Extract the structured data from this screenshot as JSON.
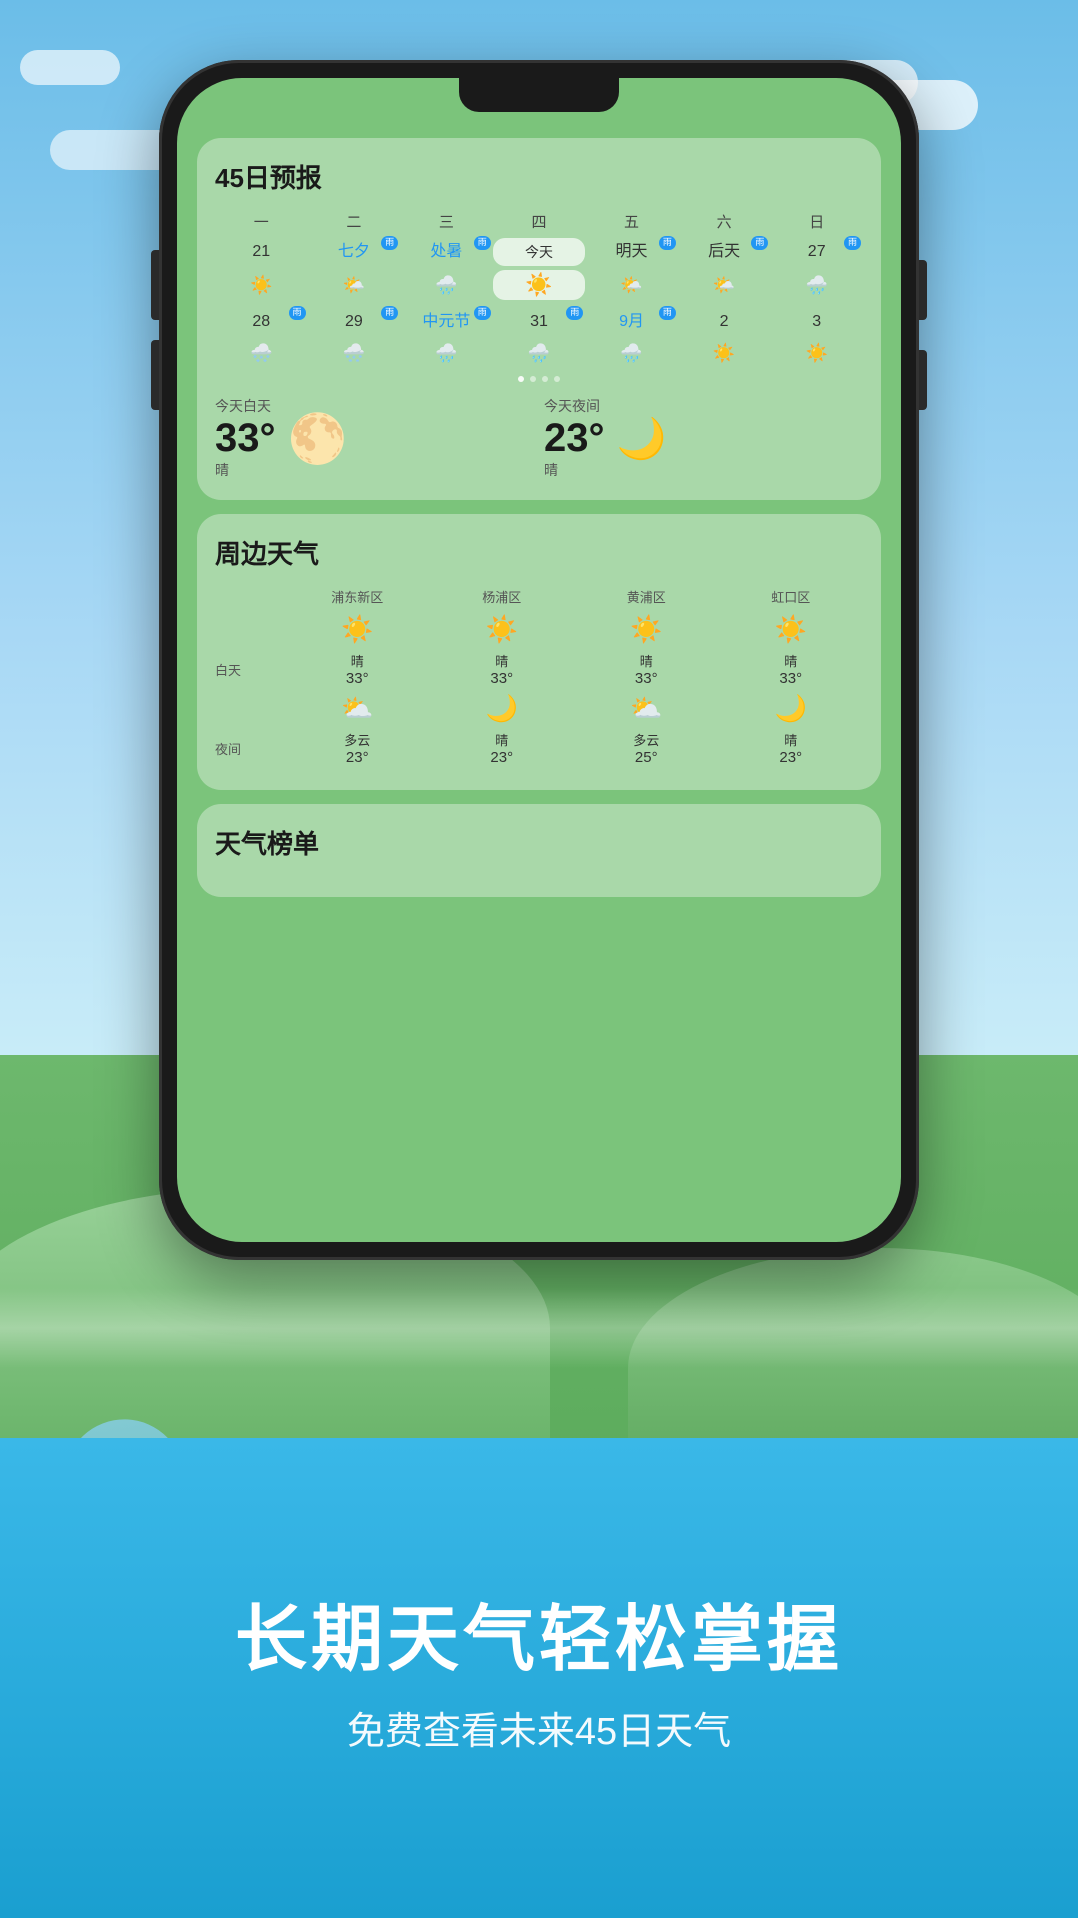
{
  "background": {
    "sky_color": "#87CEEB",
    "grass_color": "#5aaa5a"
  },
  "phone": {
    "screen_bg": "#7bc47b"
  },
  "forecast_card": {
    "title": "45日预报",
    "weekdays": [
      "一",
      "二",
      "三",
      "四",
      "五",
      "六",
      "日"
    ],
    "row1": [
      {
        "date": "21",
        "holiday": "",
        "rain": false,
        "today": false,
        "icon": "☀️"
      },
      {
        "date": "七夕",
        "holiday": "七夕",
        "rain": true,
        "today": false,
        "icon": "🌤️"
      },
      {
        "date": "处暑",
        "holiday": "处暑",
        "rain": true,
        "today": false,
        "icon": "🌧️"
      },
      {
        "date": "今天",
        "holiday": "今天",
        "rain": false,
        "today": true,
        "icon": "☀️"
      },
      {
        "date": "明天",
        "holiday": "明天",
        "rain": true,
        "today": false,
        "icon": "🌤️"
      },
      {
        "date": "后天",
        "holiday": "后天",
        "rain": true,
        "today": false,
        "icon": "🌤️"
      },
      {
        "date": "27",
        "holiday": "",
        "rain": true,
        "today": false,
        "icon": "🌧️"
      }
    ],
    "row2": [
      {
        "date": "28",
        "holiday": "",
        "rain": true,
        "today": false,
        "icon": "🌨️"
      },
      {
        "date": "29",
        "holiday": "",
        "rain": true,
        "today": false,
        "icon": "🌨️"
      },
      {
        "date": "中元节",
        "holiday": "中元节",
        "rain": true,
        "today": false,
        "icon": "🌧️"
      },
      {
        "date": "31",
        "holiday": "",
        "rain": true,
        "today": false,
        "icon": "🌧️"
      },
      {
        "date": "9月",
        "holiday": "9月",
        "rain": true,
        "today": false,
        "icon": "🌧️"
      },
      {
        "date": "2",
        "holiday": "",
        "rain": false,
        "today": false,
        "icon": "☀️"
      },
      {
        "date": "3",
        "holiday": "",
        "rain": false,
        "today": false,
        "icon": "☀️"
      }
    ],
    "day_label": "今天白天",
    "day_temp": "33°",
    "day_desc": "晴",
    "night_label": "今天夜间",
    "night_temp": "23°",
    "night_desc": "晴"
  },
  "nearby_card": {
    "title": "周边天气",
    "districts": [
      "浦东新区",
      "杨浦区",
      "黄浦区",
      "虹口区"
    ],
    "day_label": "白天",
    "night_label": "夜间",
    "day_weather": [
      {
        "icon": "☀️",
        "desc": "晴",
        "temp": "33°"
      },
      {
        "icon": "☀️",
        "desc": "晴",
        "temp": "33°"
      },
      {
        "icon": "☀️",
        "desc": "晴",
        "temp": "33°"
      },
      {
        "icon": "☀️",
        "desc": "晴",
        "temp": "33°"
      }
    ],
    "night_weather": [
      {
        "icon": "⛅",
        "desc": "多云",
        "temp": "23°"
      },
      {
        "icon": "🌙",
        "desc": "晴",
        "temp": "23°"
      },
      {
        "icon": "⛅",
        "desc": "多云",
        "temp": "25°"
      },
      {
        "icon": "🌙",
        "desc": "晴",
        "temp": "23°"
      }
    ]
  },
  "ranking_card": {
    "title": "天气榜单"
  },
  "banner": {
    "main_text": "长期天气轻松掌握",
    "sub_text": "免费查看未来45日天气"
  }
}
